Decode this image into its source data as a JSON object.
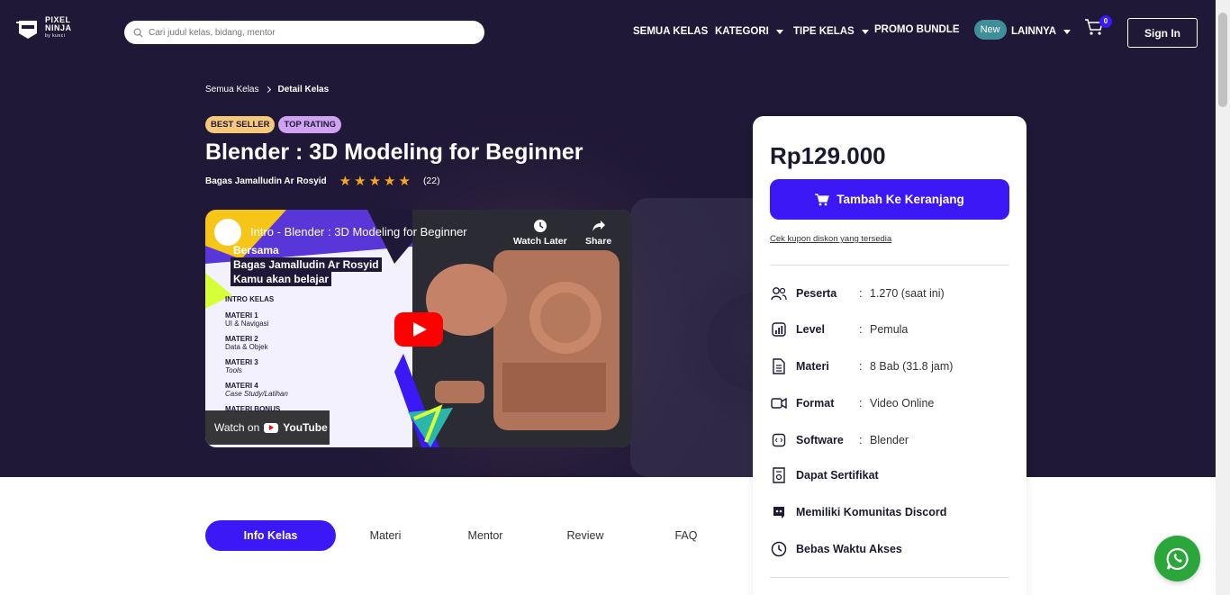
{
  "header": {
    "logo": {
      "line1": "PIXEL",
      "line2": "NINJA",
      "sub": "by kunci"
    },
    "search_placeholder": "Cari judul kelas, bidang, mentor",
    "nav": {
      "all_classes": "SEMUA KELAS",
      "category": "KATEGORI",
      "class_type": "TIPE KELAS",
      "promo": "PROMO BUNDLE",
      "promo_badge": "New",
      "more": "LAINNYA"
    },
    "cart_count": "0",
    "signin": "Sign In"
  },
  "breadcrumb": {
    "root": "Semua Kelas",
    "current": "Detail Kelas"
  },
  "tags": {
    "best": "BEST SELLER",
    "top": "TOP RATING"
  },
  "course": {
    "title": "Blender : 3D Modeling for Beginner",
    "mentor": "Bagas Jamalludin Ar Rosyid",
    "rating_stars": 5,
    "rating_count": "(22)"
  },
  "video": {
    "title": "Intro - Blender : 3D Modeling for Beginner",
    "watch_later": "Watch Later",
    "share": "Share",
    "heading1": "Bersama",
    "heading2": "Bagas Jamalludin Ar Rosyid",
    "heading3": "Kamu akan belajar",
    "intro": "INTRO KELAS",
    "materi": [
      {
        "title": "MATERI 1",
        "desc": "UI & Navigasi"
      },
      {
        "title": "MATERI 2",
        "desc": "Data & Objek"
      },
      {
        "title": "MATERI 3",
        "desc": "Tools"
      },
      {
        "title": "MATERI 4",
        "desc": "Case Study/Latihan"
      }
    ],
    "materi_bonus": "MATERI BONUS",
    "watch_on": "Watch on",
    "youtube": "YouTube"
  },
  "tabs": {
    "info": "Info Kelas",
    "materi": "Materi",
    "mentor": "Mentor",
    "review": "Review",
    "faq": "FAQ"
  },
  "card": {
    "price": "Rp129.000",
    "add_cart": "Tambah Ke Keranjang",
    "coupon": "Cek kupon diskon yang tersedia",
    "rows": [
      {
        "icon": "users-icon",
        "label": "Peserta",
        "value": "1.270 (saat ini)"
      },
      {
        "icon": "level-chart-icon",
        "label": "Level",
        "value": "Pemula"
      },
      {
        "icon": "document-icon",
        "label": "Materi",
        "value": "8 Bab (31.8 jam)"
      },
      {
        "icon": "video-camera-icon",
        "label": "Format",
        "value": "Video Online"
      },
      {
        "icon": "software-icon",
        "label": "Software",
        "value": "Blender"
      }
    ],
    "features": [
      {
        "icon": "certificate-icon",
        "label": "Dapat Sertifikat"
      },
      {
        "icon": "discord-icon",
        "label": "Memiliki Komunitas Discord"
      },
      {
        "icon": "clock-icon",
        "label": "Bebas Waktu Akses"
      }
    ]
  },
  "colors": {
    "primary": "#3b18f5",
    "hero_bg": "#1f1836",
    "whatsapp": "#2aa63a"
  }
}
